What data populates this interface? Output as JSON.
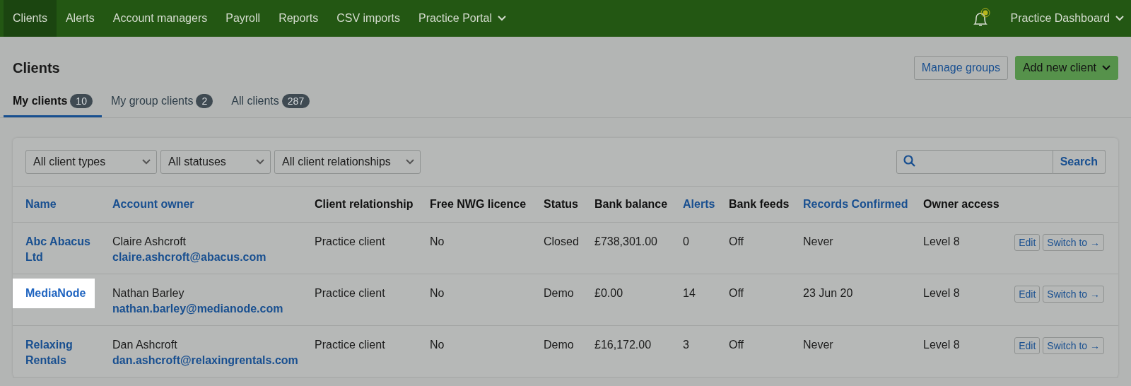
{
  "nav": {
    "items": [
      {
        "label": "Clients",
        "selected": true
      },
      {
        "label": "Alerts",
        "selected": false
      },
      {
        "label": "Account managers",
        "selected": false
      },
      {
        "label": "Payroll",
        "selected": false
      },
      {
        "label": "Reports",
        "selected": false
      },
      {
        "label": "CSV imports",
        "selected": false
      },
      {
        "label": "Practice Portal",
        "selected": false,
        "dropdown": true
      }
    ],
    "notification": true,
    "account": "Practice Dashboard"
  },
  "page": {
    "title": "Clients",
    "buttons": [
      {
        "label": "Manage groups",
        "kind": "outline"
      },
      {
        "label": "Add new client",
        "kind": "primary"
      }
    ]
  },
  "tabs": [
    {
      "label": "My clients",
      "count": "10",
      "selected": true
    },
    {
      "label": "My group clients",
      "count": "2",
      "selected": false
    },
    {
      "label": "All clients",
      "count": "287",
      "selected": false
    }
  ],
  "filters": [
    "All client types",
    "All statuses",
    "All client relationships"
  ],
  "search": {
    "button": "Search"
  },
  "table": {
    "columns": [
      {
        "label": "Name",
        "sortable": true
      },
      {
        "label": "Account owner",
        "sortable": true
      },
      {
        "label": "Client relationship",
        "sortable": false
      },
      {
        "label": "Free NWG licence",
        "sortable": false
      },
      {
        "label": "Status",
        "sortable": false
      },
      {
        "label": "Bank balance",
        "sortable": false
      },
      {
        "label": "Alerts",
        "sortable": true
      },
      {
        "label": "Bank feeds",
        "sortable": false
      },
      {
        "label": "Records Confirmed",
        "sortable": true
      },
      {
        "label": "Owner access",
        "sortable": false
      }
    ],
    "rows": [
      {
        "name": "Abc Abacus Ltd",
        "highlighted": false,
        "owner": "Claire Ashcroft",
        "email": "claire.ashcroft@abacus.com",
        "relationship": "Practice client",
        "nwg": "No",
        "status": "Closed",
        "balance": "£738,301.00",
        "alerts": "0",
        "feeds": "Off",
        "records": "Never",
        "access": "Level 8",
        "actions": [
          "Edit",
          "Switch to →"
        ]
      },
      {
        "name": "MediaNode",
        "highlighted": true,
        "owner": "Nathan Barley",
        "email": "nathan.barley@medianode.com",
        "relationship": "Practice client",
        "nwg": "No",
        "status": "Demo",
        "balance": "£0.00",
        "alerts": "14",
        "feeds": "Off",
        "records": "23 Jun 20",
        "access": "Level 8",
        "actions": [
          "Edit",
          "Switch to →"
        ]
      },
      {
        "name": "Relaxing Rentals",
        "highlighted": false,
        "owner": "Dan Ashcroft",
        "email": "dan.ashcroft@relaxingrentals.com",
        "relationship": "Practice client",
        "nwg": "No",
        "status": "Demo",
        "balance": "£16,172.00",
        "alerts": "3",
        "feeds": "Off",
        "records": "Never",
        "access": "Level 8",
        "actions": [
          "Edit",
          "Switch to →"
        ]
      }
    ]
  }
}
